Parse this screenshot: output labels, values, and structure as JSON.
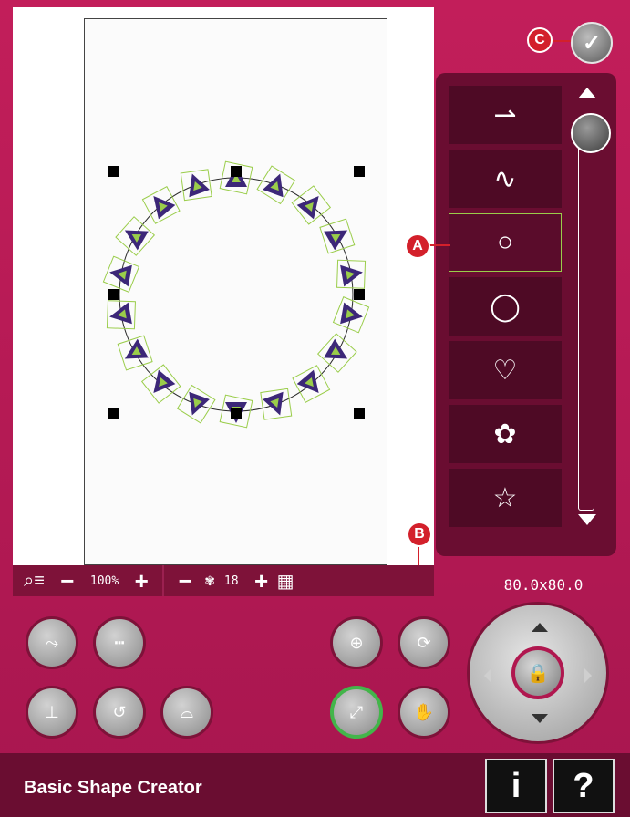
{
  "window": {
    "title": "Basic Shape Creator"
  },
  "callouts": {
    "a": "A",
    "b": "B",
    "c": "C"
  },
  "zoom": {
    "minus": "−",
    "value": "100%",
    "plus": "+"
  },
  "repeat": {
    "minus": "−",
    "count": "18",
    "plus": "+"
  },
  "dimensions": "80.0x80.0",
  "shapes": [
    {
      "name": "line",
      "glyph": "⇀"
    },
    {
      "name": "wave",
      "glyph": "∿"
    },
    {
      "name": "circle",
      "glyph": "○"
    },
    {
      "name": "circle-arrow",
      "glyph": "◯"
    },
    {
      "name": "heart",
      "glyph": "♡"
    },
    {
      "name": "flower",
      "glyph": "✿"
    },
    {
      "name": "star",
      "glyph": "☆"
    }
  ],
  "selected_shape": "circle",
  "colors": {
    "accent": "#a8164f",
    "panel": "#6a0d31",
    "selection": "#9acd4a",
    "stitch_purple": "#3c2778",
    "stitch_green": "#9acd4a",
    "callout": "#d3202b",
    "active_button": "#43b54a"
  },
  "icons": {
    "ok": "✓",
    "lock": "🔒",
    "info": "i",
    "help": "?"
  }
}
